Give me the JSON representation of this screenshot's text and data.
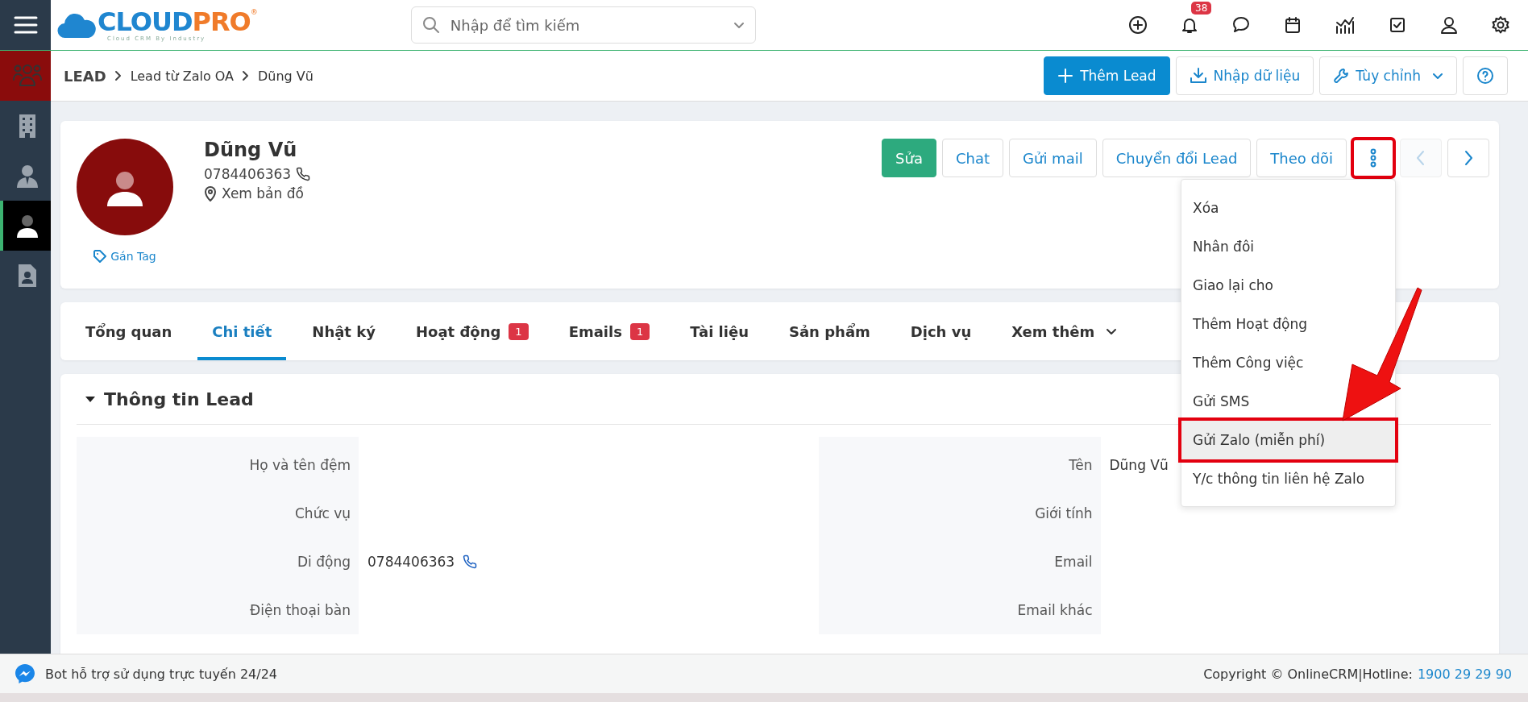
{
  "topbar": {
    "logo": {
      "word_a": "CLOUD",
      "word_b": "PRO",
      "mark": "®",
      "tagline": "Cloud CRM By Industry"
    },
    "search": {
      "placeholder": "Nhập để tìm kiếm"
    },
    "notification_count": "38"
  },
  "sidebar": {
    "items": [
      {
        "kind": "people",
        "selected": false,
        "module": true
      },
      {
        "kind": "building",
        "selected": false,
        "module": false
      },
      {
        "kind": "agent",
        "selected": false,
        "module": false
      },
      {
        "kind": "person",
        "selected": true,
        "module": false
      },
      {
        "kind": "document",
        "selected": false,
        "module": false
      }
    ]
  },
  "breadcrumb": [
    "LEAD",
    "Lead từ Zalo OA",
    "Dũng Vũ"
  ],
  "toolbar": {
    "buttons": [
      {
        "kind": "add",
        "label": "Thêm Lead"
      },
      {
        "kind": "import",
        "label": "Nhập dữ liệu"
      },
      {
        "kind": "customize",
        "label": "Tùy chỉnh"
      },
      {
        "kind": "help"
      }
    ]
  },
  "record": {
    "name": "Dũng Vũ",
    "phone": "0784406363",
    "map_link": "Xem bản đồ",
    "tag_link": "Gán Tag",
    "actions": [
      {
        "kind": "success",
        "label": "Sửa"
      },
      {
        "kind": "outline",
        "label": "Chat"
      },
      {
        "kind": "outline",
        "label": "Gửi mail"
      },
      {
        "kind": "outline",
        "label": "Chuyển đổi Lead"
      },
      {
        "kind": "outline",
        "label": "Theo dõi"
      },
      {
        "kind": "more",
        "highlighted": true
      },
      {
        "kind": "prev",
        "disabled": true
      },
      {
        "kind": "next",
        "disabled": false
      }
    ],
    "menu": [
      {
        "label": "Xóa",
        "selected": false,
        "highlighted": false
      },
      {
        "label": "Nhân đôi",
        "selected": false,
        "highlighted": false
      },
      {
        "label": "Giao lại cho",
        "selected": false,
        "highlighted": false
      },
      {
        "label": "Thêm Hoạt động",
        "selected": false,
        "highlighted": false
      },
      {
        "label": "Thêm Công việc",
        "selected": false,
        "highlighted": false
      },
      {
        "label": "Gửi SMS",
        "selected": false,
        "highlighted": false
      },
      {
        "label": "Gửi Zalo (miễn phí)",
        "selected": true,
        "highlighted": true
      },
      {
        "label": "Y/c thông tin liên hệ Zalo",
        "selected": false,
        "highlighted": false
      }
    ]
  },
  "tabs": [
    {
      "kind": "tab",
      "label": "Tổng quan",
      "selected": false
    },
    {
      "kind": "tab",
      "label": "Chi tiết",
      "selected": true
    },
    {
      "kind": "tab",
      "label": "Nhật ký",
      "selected": false
    },
    {
      "kind": "tab",
      "label": "Hoạt động",
      "badge": "1",
      "selected": false
    },
    {
      "kind": "tab",
      "label": "Emails",
      "badge": "1",
      "selected": false
    },
    {
      "kind": "tab",
      "label": "Tài liệu",
      "selected": false
    },
    {
      "kind": "tab",
      "label": "Sản phẩm",
      "selected": false
    },
    {
      "kind": "tab",
      "label": "Dịch vụ",
      "selected": false
    },
    {
      "kind": "more",
      "label": "Xem thêm",
      "selected": false
    }
  ],
  "section": {
    "title": "Thông tin Lead",
    "expanded": true,
    "left_fields": [
      {
        "label": "Họ và tên đệm"
      },
      {
        "label": "Chức vụ"
      },
      {
        "label": "Di động",
        "value": "0784406363",
        "kind": "phone"
      },
      {
        "label": "Điện thoại bàn"
      }
    ],
    "right_fields": [
      {
        "label": "Tên",
        "value": "Dũng Vũ"
      },
      {
        "label": "Giới tính"
      },
      {
        "label": "Email"
      },
      {
        "label": "Email khác"
      }
    ]
  },
  "footer": {
    "bot_text": "Bot hỗ trợ sử dụng trực tuyến 24/24",
    "copyright": "Copyright © OnlineCRM|Hotline:",
    "hotline": "1900 29 29 90"
  }
}
